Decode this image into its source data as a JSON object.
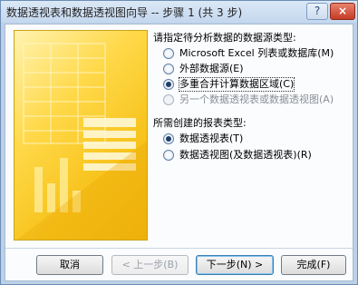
{
  "window": {
    "title": "数据透视表和数据透视图向导 -- 步骤 1 (共 3 步)",
    "help_label": "?",
    "close_label": "×"
  },
  "source": {
    "heading": "请指定待分析数据的数据源类型:",
    "options": [
      {
        "label": "Microsoft Excel 列表或数据库(M)",
        "selected": false,
        "disabled": false
      },
      {
        "label": "外部数据源(E)",
        "selected": false,
        "disabled": false
      },
      {
        "label": "多重合并计算数据区域(C)",
        "selected": true,
        "disabled": false
      },
      {
        "label": "另一个数据透视表或数据透视图(A)",
        "selected": false,
        "disabled": true
      }
    ]
  },
  "report": {
    "heading": "所需创建的报表类型:",
    "options": [
      {
        "label": "数据透视表(T)",
        "selected": true,
        "disabled": false
      },
      {
        "label": "数据透视图(及数据透视表)(R)",
        "selected": false,
        "disabled": false
      }
    ]
  },
  "buttons": {
    "cancel": "取消",
    "back": "< 上一步(B)",
    "next": "下一步(N) >",
    "finish": "完成(F)"
  }
}
